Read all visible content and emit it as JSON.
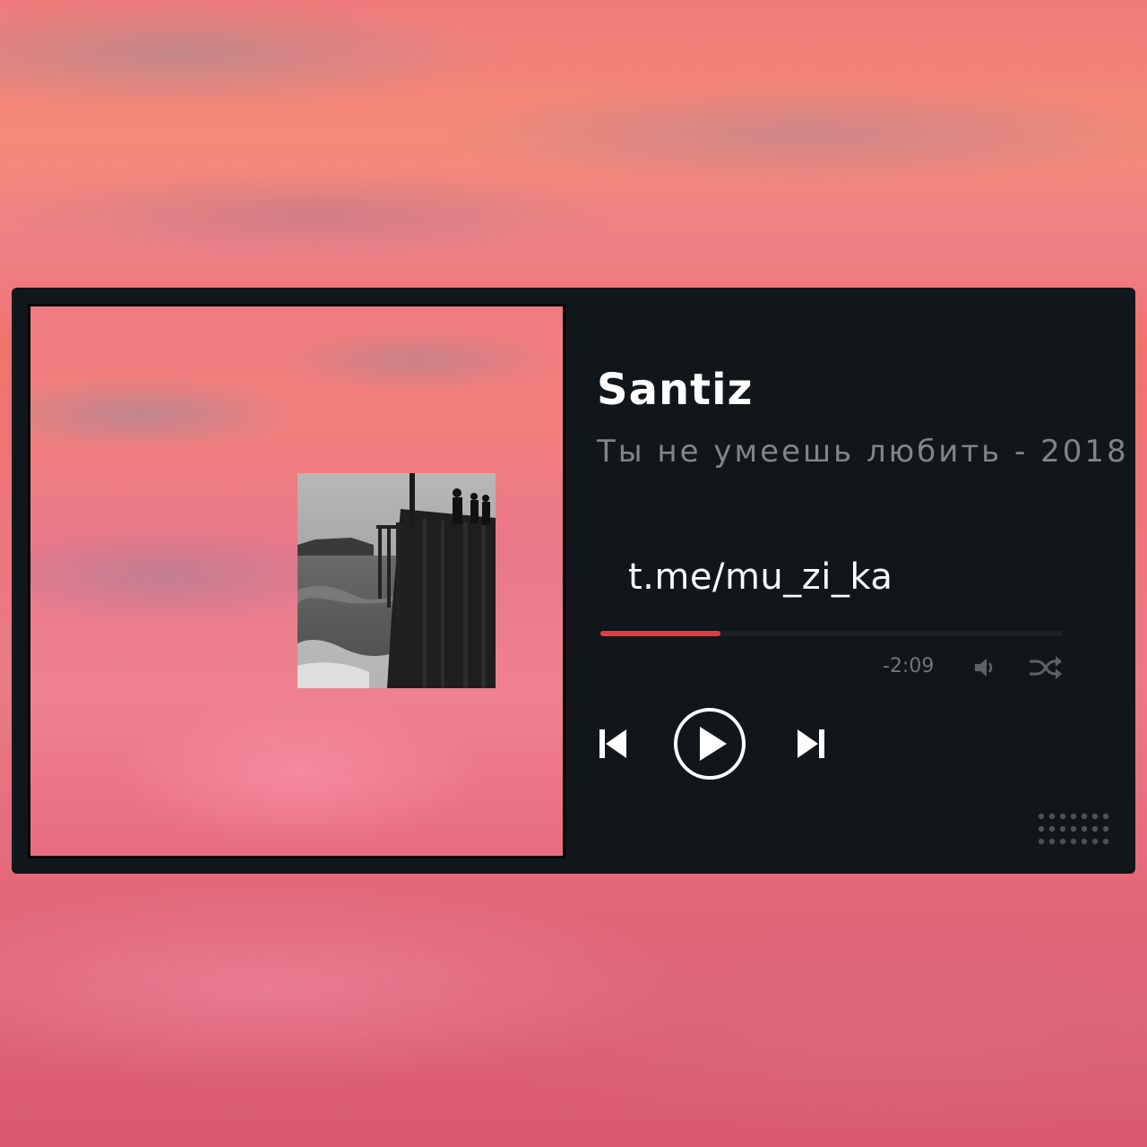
{
  "track": {
    "artist": "Santiz",
    "subtitle": "Ты не умеешь любить - 2018",
    "link": "t.me/mu_zi_ka",
    "remaining_time": "-2:09",
    "progress": 0.26
  },
  "icons": {
    "volume": "volume-icon",
    "shuffle": "shuffle-icon",
    "previous": "skip-previous-icon",
    "play": "play-icon",
    "next": "skip-next-icon",
    "more": "dots-grid-icon"
  },
  "colors": {
    "player_bg": "#11161a",
    "accent": "#e43c3c",
    "text_primary": "#ffffff",
    "text_secondary": "#80858a",
    "icon_muted": "#6f7479"
  }
}
